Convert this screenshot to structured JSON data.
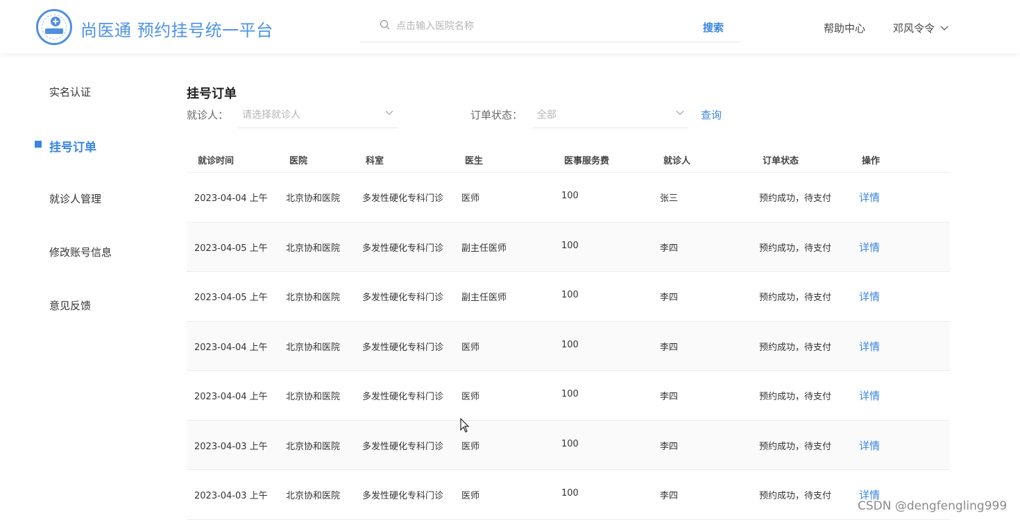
{
  "header": {
    "site_title": "尚医通 预约挂号统一平台",
    "search_placeholder": "点击输入医院名称",
    "search_button": "搜索",
    "help_center": "帮助中心",
    "user_name": "邓风令令"
  },
  "sidebar": {
    "items": [
      {
        "label": "实名认证",
        "active": false
      },
      {
        "label": "挂号订单",
        "active": true
      },
      {
        "label": "就诊人管理",
        "active": false
      },
      {
        "label": "修改账号信息",
        "active": false
      },
      {
        "label": "意见反馈",
        "active": false
      }
    ]
  },
  "main": {
    "title": "挂号订单",
    "filters": {
      "patient_label": "就诊人：",
      "patient_placeholder": "请选择就诊人",
      "status_label": "订单状态：",
      "status_value": "全部",
      "query_button": "查询"
    },
    "table": {
      "columns": [
        "就诊时间",
        "医院",
        "科室",
        "医生",
        "医事服务费",
        "就诊人",
        "订单状态",
        "操作"
      ],
      "rows": [
        {
          "time": "2023-04-04 上午",
          "hospital": "北京协和医院",
          "department": "多发性硬化专科门诊",
          "doctor": "医师",
          "fee": "100",
          "patient": "张三",
          "status": "预约成功，待支付",
          "action": "详情"
        },
        {
          "time": "2023-04-05 上午",
          "hospital": "北京协和医院",
          "department": "多发性硬化专科门诊",
          "doctor": "副主任医师",
          "fee": "100",
          "patient": "李四",
          "status": "预约成功，待支付",
          "action": "详情"
        },
        {
          "time": "2023-04-05 上午",
          "hospital": "北京协和医院",
          "department": "多发性硬化专科门诊",
          "doctor": "副主任医师",
          "fee": "100",
          "patient": "李四",
          "status": "预约成功，待支付",
          "action": "详情"
        },
        {
          "time": "2023-04-04 上午",
          "hospital": "北京协和医院",
          "department": "多发性硬化专科门诊",
          "doctor": "医师",
          "fee": "100",
          "patient": "李四",
          "status": "预约成功，待支付",
          "action": "详情"
        },
        {
          "time": "2023-04-04 上午",
          "hospital": "北京协和医院",
          "department": "多发性硬化专科门诊",
          "doctor": "医师",
          "fee": "100",
          "patient": "李四",
          "status": "预约成功，待支付",
          "action": "详情"
        },
        {
          "time": "2023-04-03 上午",
          "hospital": "北京协和医院",
          "department": "多发性硬化专科门诊",
          "doctor": "医师",
          "fee": "100",
          "patient": "李四",
          "status": "预约成功，待支付",
          "action": "详情"
        },
        {
          "time": "2023-04-03 上午",
          "hospital": "北京协和医院",
          "department": "多发性硬化专科门诊",
          "doctor": "医师",
          "fee": "100",
          "patient": "李四",
          "status": "预约成功，待支付",
          "action": "详情"
        }
      ]
    }
  },
  "watermark": "CSDN @dengfengling999",
  "colors": {
    "accent": "#3a85e0",
    "title_blue": "#4d92e6",
    "row_alt": "#fafafa"
  }
}
